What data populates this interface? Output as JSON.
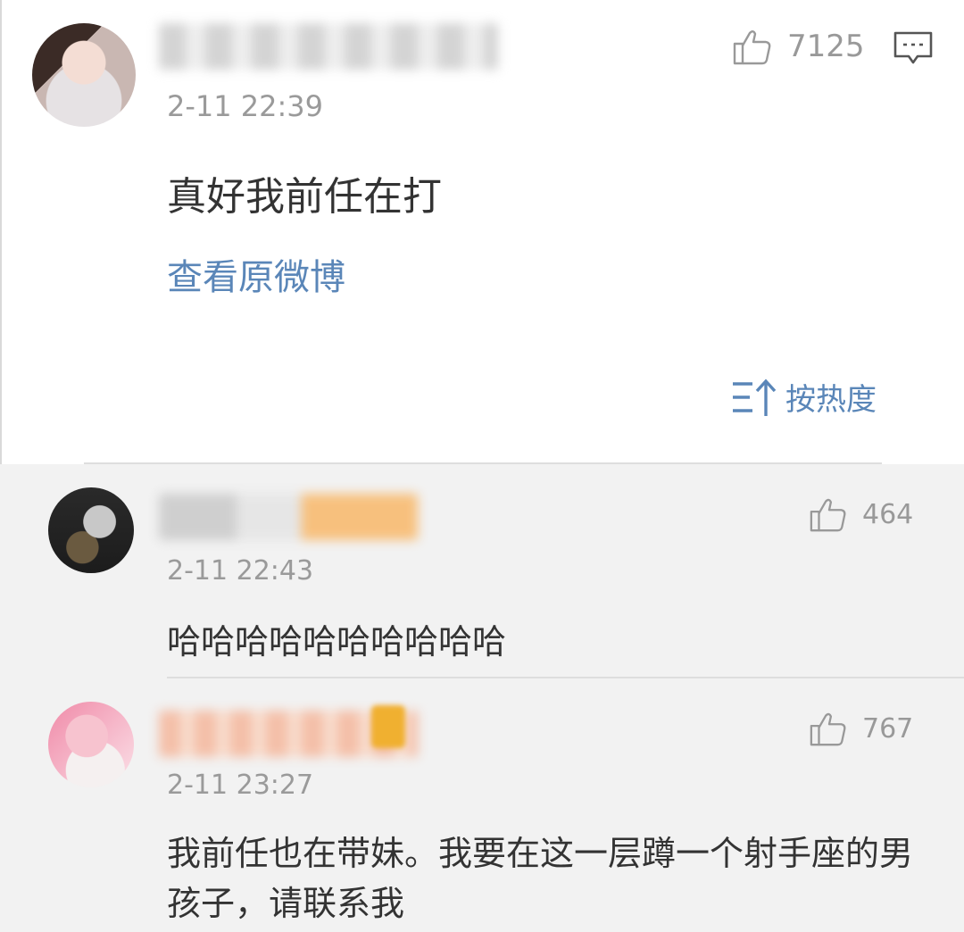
{
  "main_comment": {
    "time": "2-11 22:39",
    "text": "真好我前任在打",
    "likes": "7125",
    "view_original": "查看原微博"
  },
  "sort": {
    "label": "按热度"
  },
  "replies": [
    {
      "time": "2-11 22:43",
      "text": "哈哈哈哈哈哈哈哈哈哈",
      "likes": "464"
    },
    {
      "time": "2-11 23:27",
      "text": "我前任也在带妹。我要在这一层蹲一个射手座的男孩子，请联系我",
      "likes": "767"
    }
  ],
  "colors": {
    "link": "#5a86b8",
    "muted": "#9a9a9a",
    "reply_bg": "#f2f2f2"
  },
  "icons": [
    "thumbs-up-icon",
    "comment-icon",
    "sort-icon"
  ]
}
